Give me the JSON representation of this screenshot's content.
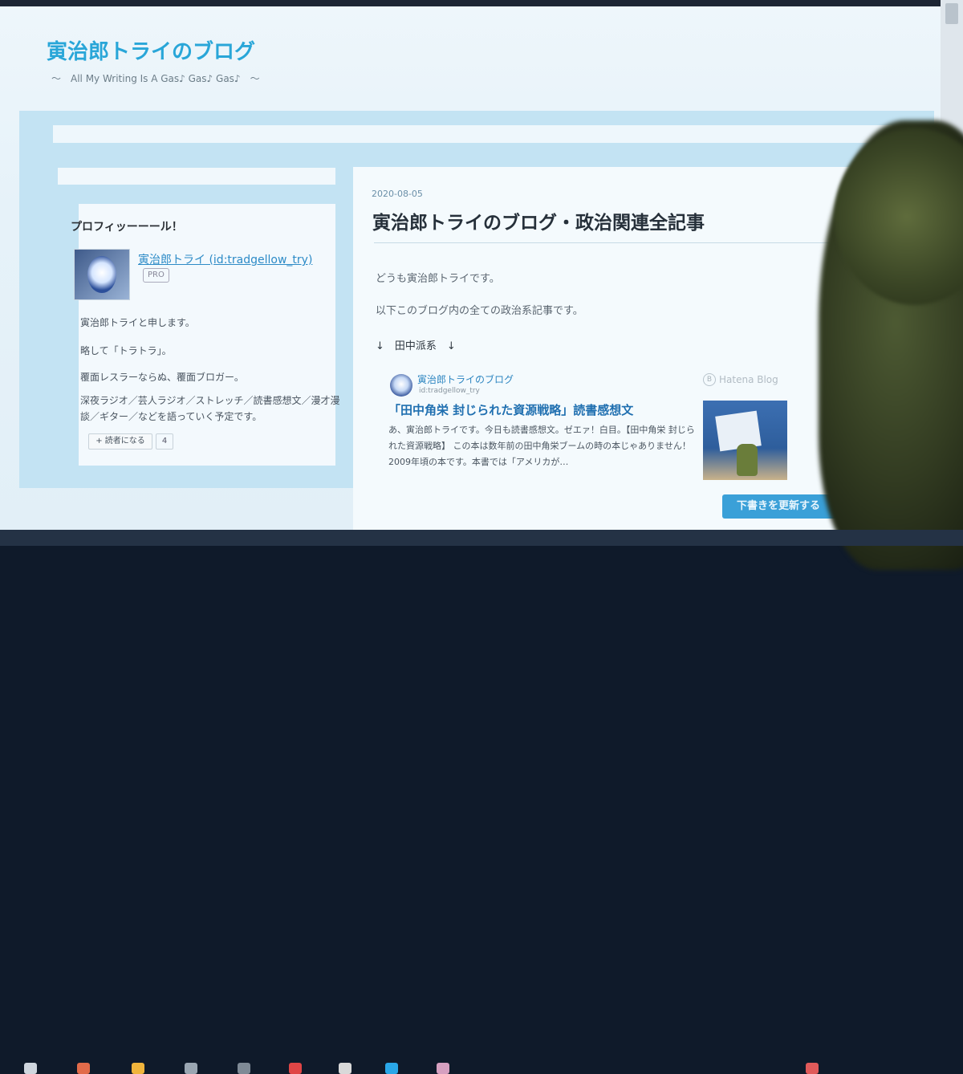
{
  "blog": {
    "title": "寅治郎トライのブログ",
    "tagline": "～　All My Writing Is A Gas♪ Gas♪ Gas♪　～"
  },
  "profile": {
    "heading": "プロフィッーーール！",
    "name": "寅治郎トライ (id:tradgellow_try)",
    "badge": "PRO",
    "lines": [
      "寅治郎トライと申します。",
      "略して「トラトラ」。",
      "覆面レスラーならぬ、覆面ブロガー。",
      "深夜ラジオ／芸人ラジオ／ストレッチ／読書感想文／漫才漫談／ギター／などを語っていく予定です。"
    ],
    "reader_button": "+ 読者になる",
    "reader_count": "4"
  },
  "article": {
    "date": "2020-08-05",
    "title": "寅治郎トライのブログ・政治関連全記事",
    "paragraphs": [
      "どうも寅治郎トライです。",
      "以下このブログ内の全ての政治系記事です。",
      "↓　田中派系　↓"
    ]
  },
  "card": {
    "blog_name": "寅治郎トライのブログ",
    "blog_id": "id:tradgellow_try",
    "source_label": "Hatena Blog",
    "title": "「田中角栄 封じられた資源戦略」読書感想文",
    "excerpt": "あ、寅治郎トライです。今日も読書感想文。ゼエァ！白目。【田中角栄 封じられた資源戦略】 この本は数年前の田中角栄ブームの時の本じゃありません！2009年頃の本です。本書では「アメリカが…"
  },
  "editor": {
    "update_button": "下書きを更新する",
    "dropdown_icon": "chevron-down-icon"
  },
  "colors": {
    "accent": "#29a6d8",
    "link": "#2e86c1",
    "button": "#3aa0d8"
  }
}
